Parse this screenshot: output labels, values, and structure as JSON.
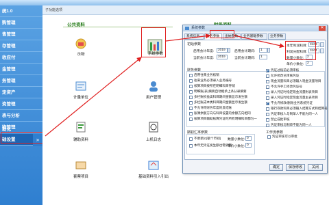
{
  "window": {
    "title": "",
    "tab": "子功能选项"
  },
  "sidebar": {
    "items": [
      {
        "label": "统1.0"
      },
      {
        "label": "购管理"
      },
      {
        "label": "售管理"
      },
      {
        "label": "存管理"
      },
      {
        "label": "收应付"
      },
      {
        "label": "金管理"
      },
      {
        "label": "务管理"
      },
      {
        "label": "定资产"
      },
      {
        "label": "资管理"
      },
      {
        "label": "表与分析"
      },
      {
        "label": "物管理"
      },
      {
        "label": "助化"
      },
      {
        "label": "础设置"
      }
    ],
    "selected_index": 12,
    "collapse_glyph": "»"
  },
  "main": {
    "group_public": "公共资料",
    "group_finance": "财务资料",
    "icons": [
      {
        "name": "supplier",
        "label": "示物"
      },
      {
        "name": "unit",
        "label": "计量单位"
      },
      {
        "name": "aux",
        "label": "辅助资料"
      },
      {
        "name": "settings",
        "label": "系统参数"
      },
      {
        "name": "user",
        "label": "用户管理"
      },
      {
        "name": "log",
        "label": "上机日志"
      },
      {
        "name": "tpl",
        "label": "套票项目"
      },
      {
        "name": "initfin",
        "label": "基础资料引入引出"
      }
    ]
  },
  "dialog": {
    "title": "系统参数",
    "close": "✕",
    "tabs": [
      "系统信息",
      "财务参数",
      "出纳参数",
      "业务基础参数",
      "业务参数"
    ],
    "active_tab": 1,
    "init_section": "初始参数",
    "start_year_label": "启用会计年度:",
    "start_year": "2019",
    "start_period_label": "启用会计期间:",
    "start_period": "1",
    "cur_year_label": "当前会计年度:",
    "cur_year": "2019",
    "cur_period_label": "当前会计期间:",
    "cur_period": "1",
    "right_year_label": "本年利润科目:",
    "right_year": "3103",
    "right_profit_label": "利润分配科目:",
    "right_profit": "3104",
    "qty_label": "数量小数位:",
    "qty": "2",
    "price_label": "单价小数位:",
    "price": "2",
    "fin_section": "财务参数",
    "checks_left": [
      {
        "label": "启用往来业务核销",
        "on": false
      },
      {
        "label": "往来业务必须录入业务编号",
        "on": false
      },
      {
        "label": "核算项目按所在明细科目存储",
        "on": false
      },
      {
        "label": "明细账(表)摘要自动继承上条分录摘要",
        "on": false
      },
      {
        "label": "多栏账损益类科目期间金额显示发生额",
        "on": false
      },
      {
        "label": "多栏账成本类科目期间金额显示发生额",
        "on": false
      },
      {
        "label": "不允许跨财务年度的反结账",
        "on": false
      },
      {
        "label": "账簿余额方向与科目设置的余额方向相同",
        "on": false
      },
      {
        "label": "核算项目辅助核算凭证时所有明细科目都为一",
        "on": false
      }
    ],
    "checks_right": [
      {
        "label": "凭证过账前必须审核",
        "on": true
      },
      {
        "label": "允许修改已审核凭证",
        "on": false
      },
      {
        "label": "现金流量科目必须输入现金流量项目",
        "on": false
      },
      {
        "label": "不允许手工修改凭证号",
        "on": false
      },
      {
        "label": "录入凭证时指定现金流量附表项目",
        "on": false
      },
      {
        "label": "录入凭证时指定现金流量主表项目",
        "on": false
      },
      {
        "label": "不允许修改/删除业务系统凭证",
        "on": true
      },
      {
        "label": "银行存款科目必须输入结算方式和结算号",
        "on": false
      },
      {
        "label": "凭证审核人与制单人不能为同一人",
        "on": false
      },
      {
        "label": "禁止成批审核",
        "on": false
      },
      {
        "label": "凭证审核与制单不能为同一人",
        "on": false
      }
    ],
    "fx_section": "期初汇率参数",
    "fx_checks": [
      {
        "label": "不更新(0)额个币别)",
        "on": false
      },
      {
        "label": "本年无凭证发生额也需调整",
        "on": false
      }
    ],
    "fx_qty_label": "数量小数位:",
    "fx_qty": "0",
    "fx_price_label": "单价小数位:",
    "fx_price": "0",
    "workflow_section": "工作流参数",
    "workflow_check": "凭证审核可以审批",
    "buttons": [
      "确定",
      "保存修改",
      "关闭"
    ]
  },
  "colors": {
    "sidebar": "#2f7fd0",
    "highlight": "#e02020",
    "group_title": "#2a7e1d"
  }
}
